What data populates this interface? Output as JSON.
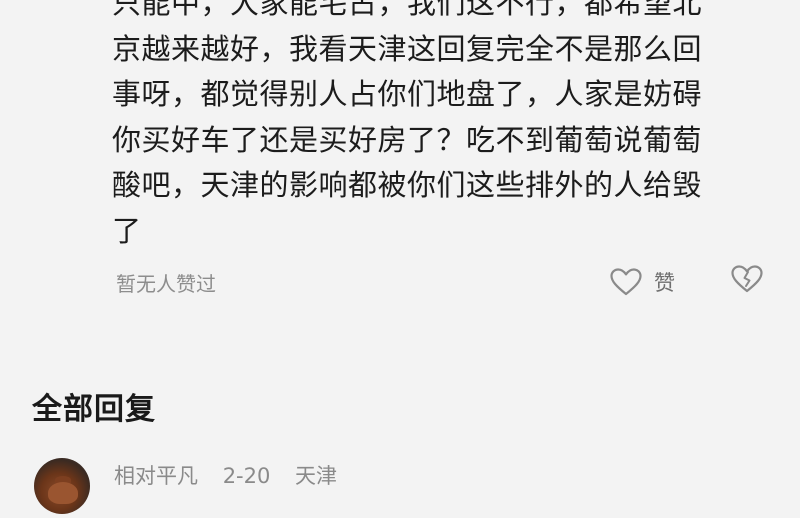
{
  "comment": {
    "lines": [
      "只能中，大家能宅占，我们这不行，都希望北",
      "京越来越好，我看天津这回复完全不是那么回",
      "事呀，都觉得别人占你们地盘了，人家是妨碍",
      "你买好车了还是买好房了？吃不到葡萄说葡萄",
      "酸吧，天津的影响都被你们这些排外的人给毁",
      "了"
    ],
    "no_likes_text": "暂无人赞过",
    "like_label": "赞",
    "like_icon": "heart-outline-icon",
    "dislike_icon": "broken-heart-icon"
  },
  "replies_section": {
    "title": "全部回复",
    "first_reply": {
      "avatar": "teapot-avatar",
      "username": "相对平凡",
      "date": "2-20",
      "location": "天津"
    }
  }
}
